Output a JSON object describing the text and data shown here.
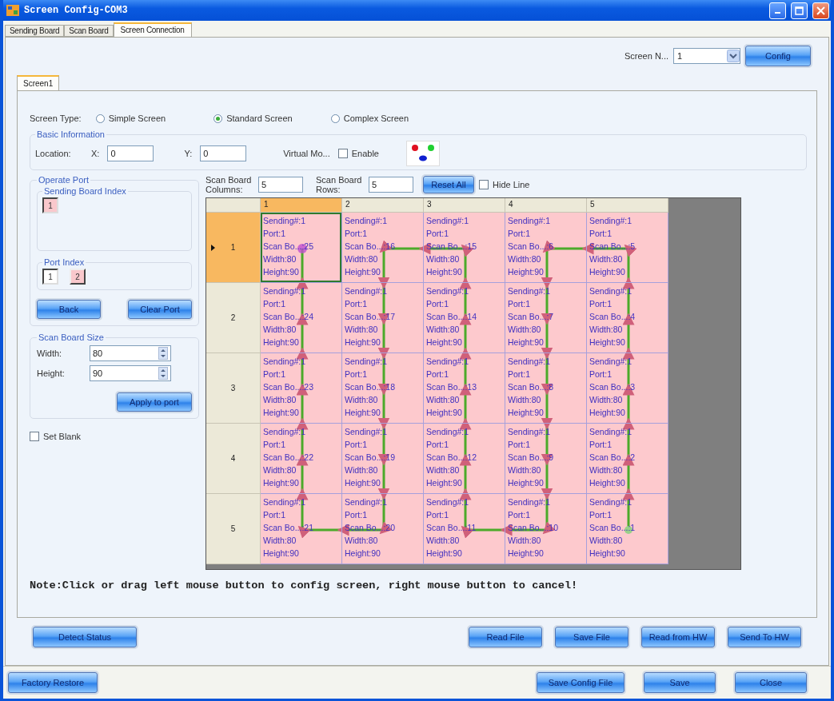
{
  "window": {
    "title": "Screen Config-COM3"
  },
  "tabs": [
    {
      "label": "Sending Board",
      "selected": false
    },
    {
      "label": "Scan Board",
      "selected": false
    },
    {
      "label": "Screen Connection",
      "selected": true
    }
  ],
  "screen_selector": {
    "label": "Screen N...",
    "value": "1",
    "button": "Config"
  },
  "inner_tabs": [
    {
      "label": "Screen1",
      "selected": true
    }
  ],
  "screen_type": {
    "label": "Screen Type:",
    "options": [
      {
        "label": "Simple Screen",
        "selected": false
      },
      {
        "label": "Standard Screen",
        "selected": true
      },
      {
        "label": "Complex Screen",
        "selected": false
      }
    ]
  },
  "basic_information": {
    "title": "Basic Information",
    "location_label": "Location:",
    "x_label": "X:",
    "x_value": "0",
    "y_label": "Y:",
    "y_value": "0",
    "virtual_label": "Virtual Mo...",
    "enable": {
      "label": "Enable",
      "checked": false
    }
  },
  "operate_port": {
    "title": "Operate Port",
    "sending_board_index": {
      "title": "Sending Board Index",
      "items": [
        {
          "label": "1",
          "selected": true,
          "assigned": true
        }
      ]
    },
    "port_index": {
      "title": "Port Index",
      "items": [
        {
          "label": "1",
          "selected": true,
          "assigned": false
        },
        {
          "label": "2",
          "selected": false,
          "assigned": true
        }
      ]
    },
    "buttons": [
      "Back",
      "Clear Port"
    ]
  },
  "scan_board_size": {
    "title": "Scan Board Size",
    "width_label": "Width:",
    "width_value": "80",
    "height_label": "Height:",
    "height_value": "90",
    "button": "Apply to port"
  },
  "set_blank": {
    "label": "Set Blank",
    "checked": false
  },
  "grid_settings": {
    "columns_label": "Scan Board Columns:",
    "columns_value": "5",
    "rows_label": "Scan Board Rows:",
    "rows_value": "5",
    "reset_button": "Reset All",
    "hide_line": {
      "label": "Hide Line",
      "checked": false
    }
  },
  "grid": {
    "columns": [
      {
        "label": "1",
        "selected": true
      },
      {
        "label": "2",
        "selected": false
      },
      {
        "label": "3",
        "selected": false
      },
      {
        "label": "4",
        "selected": false
      },
      {
        "label": "5",
        "selected": false
      }
    ],
    "rows": [
      {
        "label": "1",
        "selected": true,
        "cells": [
          {
            "selected": true,
            "lines": [
              "Sending#:1",
              "Port:1",
              "Scan Bo...:25",
              "Width:80",
              "Height:90"
            ]
          },
          {
            "selected": false,
            "lines": [
              "Sending#:1",
              "Port:1",
              "Scan Bo...:16",
              "Width:80",
              "Height:90"
            ]
          },
          {
            "selected": false,
            "lines": [
              "Sending#:1",
              "Port:1",
              "Scan Bo...:15",
              "Width:80",
              "Height:90"
            ]
          },
          {
            "selected": false,
            "lines": [
              "Sending#:1",
              "Port:1",
              "Scan Bo...:6",
              "Width:80",
              "Height:90"
            ]
          },
          {
            "selected": false,
            "lines": [
              "Sending#:1",
              "Port:1",
              "Scan Bo...:5",
              "Width:80",
              "Height:90"
            ]
          }
        ]
      },
      {
        "label": "2",
        "selected": false,
        "cells": [
          {
            "selected": false,
            "lines": [
              "Sending#:1",
              "Port:1",
              "Scan Bo...:24",
              "Width:80",
              "Height:90"
            ]
          },
          {
            "selected": false,
            "lines": [
              "Sending#:1",
              "Port:1",
              "Scan Bo...:17",
              "Width:80",
              "Height:90"
            ]
          },
          {
            "selected": false,
            "lines": [
              "Sending#:1",
              "Port:1",
              "Scan Bo...:14",
              "Width:80",
              "Height:90"
            ]
          },
          {
            "selected": false,
            "lines": [
              "Sending#:1",
              "Port:1",
              "Scan Bo...:7",
              "Width:80",
              "Height:90"
            ]
          },
          {
            "selected": false,
            "lines": [
              "Sending#:1",
              "Port:1",
              "Scan Bo...:4",
              "Width:80",
              "Height:90"
            ]
          }
        ]
      },
      {
        "label": "3",
        "selected": false,
        "cells": [
          {
            "selected": false,
            "lines": [
              "Sending#:1",
              "Port:1",
              "Scan Bo...:23",
              "Width:80",
              "Height:90"
            ]
          },
          {
            "selected": false,
            "lines": [
              "Sending#:1",
              "Port:1",
              "Scan Bo...:18",
              "Width:80",
              "Height:90"
            ]
          },
          {
            "selected": false,
            "lines": [
              "Sending#:1",
              "Port:1",
              "Scan Bo...:13",
              "Width:80",
              "Height:90"
            ]
          },
          {
            "selected": false,
            "lines": [
              "Sending#:1",
              "Port:1",
              "Scan Bo...:8",
              "Width:80",
              "Height:90"
            ]
          },
          {
            "selected": false,
            "lines": [
              "Sending#:1",
              "Port:1",
              "Scan Bo...:3",
              "Width:80",
              "Height:90"
            ]
          }
        ]
      },
      {
        "label": "4",
        "selected": false,
        "cells": [
          {
            "selected": false,
            "lines": [
              "Sending#:1",
              "Port:1",
              "Scan Bo...:22",
              "Width:80",
              "Height:90"
            ]
          },
          {
            "selected": false,
            "lines": [
              "Sending#:1",
              "Port:1",
              "Scan Bo...:19",
              "Width:80",
              "Height:90"
            ]
          },
          {
            "selected": false,
            "lines": [
              "Sending#:1",
              "Port:1",
              "Scan Bo...:12",
              "Width:80",
              "Height:90"
            ]
          },
          {
            "selected": false,
            "lines": [
              "Sending#:1",
              "Port:1",
              "Scan Bo...:9",
              "Width:80",
              "Height:90"
            ]
          },
          {
            "selected": false,
            "lines": [
              "Sending#:1",
              "Port:1",
              "Scan Bo...:2",
              "Width:80",
              "Height:90"
            ]
          }
        ]
      },
      {
        "label": "5",
        "selected": false,
        "cells": [
          {
            "selected": false,
            "lines": [
              "Sending#:1",
              "Port:1",
              "Scan Bo...:21",
              "Width:80",
              "Height:90"
            ]
          },
          {
            "selected": false,
            "lines": [
              "Sending#:1",
              "Port:1",
              "Scan Bo...:20",
              "Width:80",
              "Height:90"
            ]
          },
          {
            "selected": false,
            "lines": [
              "Sending#:1",
              "Port:1",
              "Scan Bo...:11",
              "Width:80",
              "Height:90"
            ]
          },
          {
            "selected": false,
            "lines": [
              "Sending#:1",
              "Port:1",
              "Scan Bo...:10",
              "Width:80",
              "Height:90"
            ]
          },
          {
            "selected": false,
            "lines": [
              "Sending#:1",
              "Port:1",
              "Scan Bo...:1",
              "Width:80",
              "Height:90"
            ]
          }
        ]
      }
    ]
  },
  "note": "Note:Click or drag left mouse button to config screen, right mouse button to cancel!",
  "action_buttons_left": [
    "Detect Status"
  ],
  "action_buttons_right": [
    "Read File",
    "Save File",
    "Read from HW",
    "Send To HW"
  ],
  "footer_left": [
    "Factory Restore"
  ],
  "footer_right": [
    "Save Config File",
    "Save",
    "Close"
  ]
}
